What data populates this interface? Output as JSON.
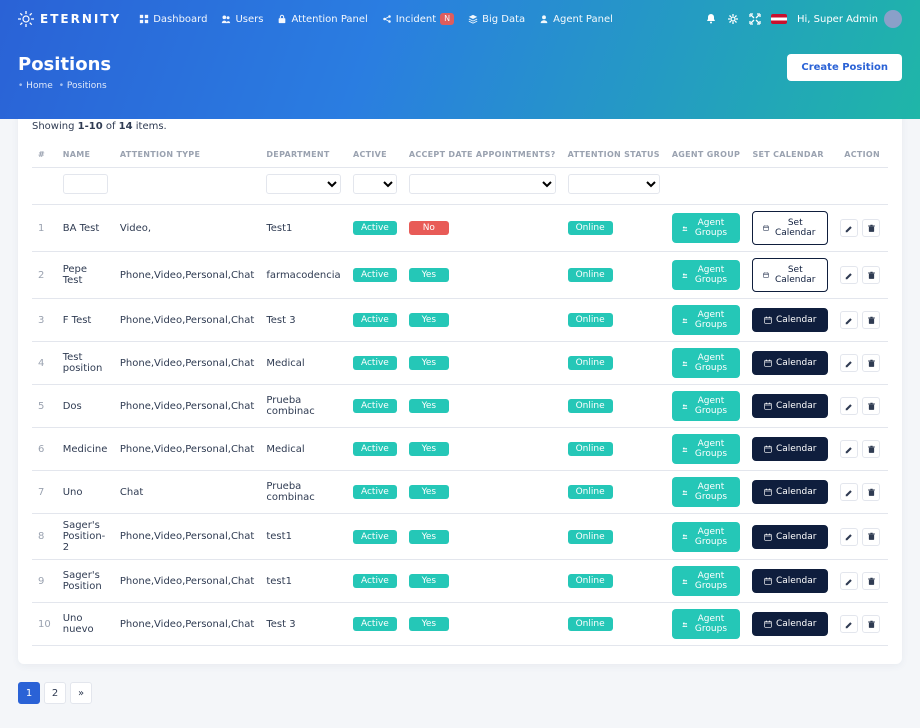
{
  "brand": "ETERNITY",
  "nav": {
    "items": [
      {
        "icon": "grid",
        "label": "Dashboard"
      },
      {
        "icon": "users",
        "label": "Users"
      },
      {
        "icon": "lock",
        "label": "Attention Panel"
      },
      {
        "icon": "share",
        "label": "Incident",
        "badge": "N"
      },
      {
        "icon": "layers",
        "label": "Big Data"
      },
      {
        "icon": "user",
        "label": "Agent Panel"
      }
    ],
    "user_greeting": "Hi, Super Admin"
  },
  "page": {
    "title": "Positions",
    "crumb_home": "Home",
    "crumb_current": "Positions",
    "create_btn": "Create Position"
  },
  "table": {
    "summary_prefix": "Showing ",
    "summary_range": "1-10",
    "summary_mid": " of ",
    "summary_total": "14",
    "summary_suffix": " items.",
    "headers": {
      "idx": "#",
      "name": "NAME",
      "attention": "ATTENTION TYPE",
      "department": "DEPARTMENT",
      "active": "ACTIVE",
      "accept": "ACCEPT DATE APPOINTMENTS?",
      "status": "ATTENTION STATUS",
      "group": "AGENT GROUP",
      "calendar": "SET CALENDAR",
      "actions": "ACTION"
    },
    "btn_group": "Agent Groups",
    "btn_setcal": "Set Calendar",
    "btn_cal": "Calendar",
    "rows": [
      {
        "idx": "1",
        "name": "BA Test",
        "attention": "Video,",
        "department": "Test1",
        "active": "Active",
        "accept": "No",
        "accept_kind": "red",
        "status": "Online",
        "cal": "set"
      },
      {
        "idx": "2",
        "name": "Pepe Test",
        "attention": "Phone,Video,Personal,Chat",
        "department": "farmacodencia",
        "active": "Active",
        "accept": "Yes",
        "accept_kind": "teal",
        "status": "Online",
        "cal": "set"
      },
      {
        "idx": "3",
        "name": "F Test",
        "attention": "Phone,Video,Personal,Chat",
        "department": "Test 3",
        "active": "Active",
        "accept": "Yes",
        "accept_kind": "teal",
        "status": "Online",
        "cal": "cal"
      },
      {
        "idx": "4",
        "name": "Test position",
        "attention": "Phone,Video,Personal,Chat",
        "department": "Medical",
        "active": "Active",
        "accept": "Yes",
        "accept_kind": "teal",
        "status": "Online",
        "cal": "cal"
      },
      {
        "idx": "5",
        "name": "Dos",
        "attention": "Phone,Video,Personal,Chat",
        "department": "Prueba combinac",
        "active": "Active",
        "accept": "Yes",
        "accept_kind": "teal",
        "status": "Online",
        "cal": "cal"
      },
      {
        "idx": "6",
        "name": "Medicine",
        "attention": "Phone,Video,Personal,Chat",
        "department": "Medical",
        "active": "Active",
        "accept": "Yes",
        "accept_kind": "teal",
        "status": "Online",
        "cal": "cal"
      },
      {
        "idx": "7",
        "name": "Uno",
        "attention": "Chat",
        "department": "Prueba combinac",
        "active": "Active",
        "accept": "Yes",
        "accept_kind": "teal",
        "status": "Online",
        "cal": "cal"
      },
      {
        "idx": "8",
        "name": "Sager's Position-2",
        "attention": "Phone,Video,Personal,Chat",
        "department": "test1",
        "active": "Active",
        "accept": "Yes",
        "accept_kind": "teal",
        "status": "Online",
        "cal": "cal"
      },
      {
        "idx": "9",
        "name": "Sager's Position",
        "attention": "Phone,Video,Personal,Chat",
        "department": "test1",
        "active": "Active",
        "accept": "Yes",
        "accept_kind": "teal",
        "status": "Online",
        "cal": "cal"
      },
      {
        "idx": "10",
        "name": "Uno nuevo",
        "attention": "Phone,Video,Personal,Chat",
        "department": "Test 3",
        "active": "Active",
        "accept": "Yes",
        "accept_kind": "teal",
        "status": "Online",
        "cal": "cal"
      }
    ]
  },
  "pagination": {
    "pages": [
      "1",
      "2"
    ],
    "next": "»",
    "active": 0
  }
}
